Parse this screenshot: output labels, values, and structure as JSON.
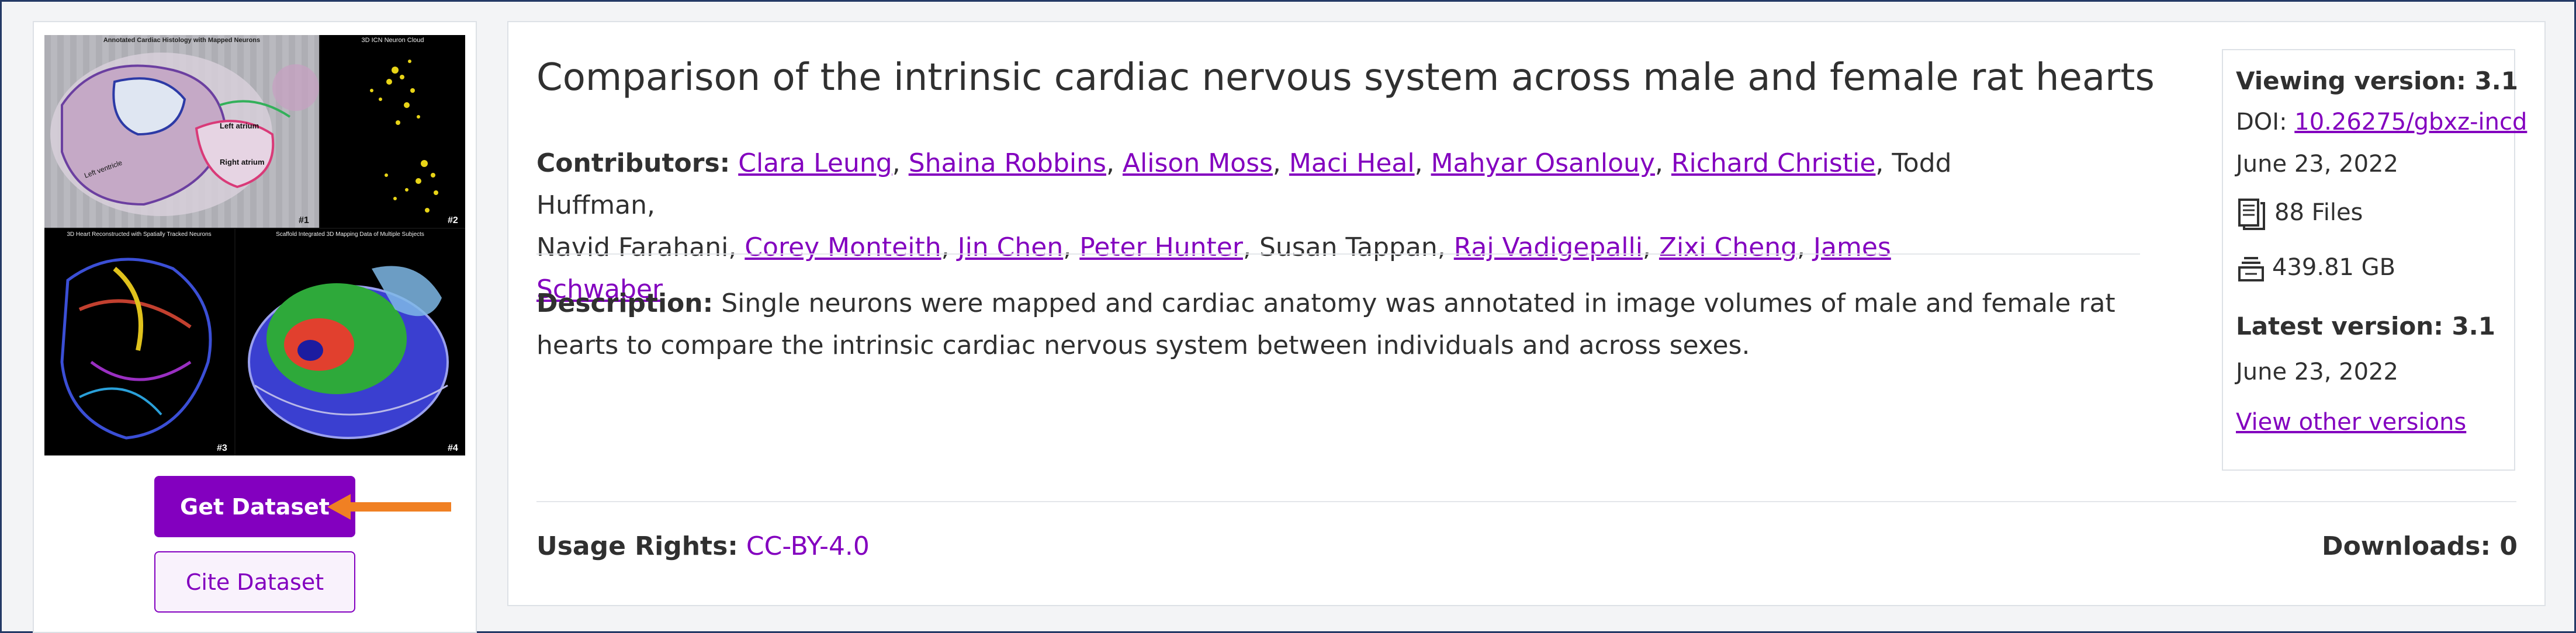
{
  "dataset": {
    "title": "Comparison of the intrinsic cardiac nervous system across male and female rat hearts",
    "contributors_label": "Contributors:",
    "contributors": [
      {
        "name": "Clara Leung",
        "linked": true
      },
      {
        "name": "Shaina Robbins",
        "linked": true
      },
      {
        "name": "Alison Moss",
        "linked": true
      },
      {
        "name": "Maci Heal",
        "linked": true
      },
      {
        "name": "Mahyar Osanlouy",
        "linked": true
      },
      {
        "name": "Richard Christie",
        "linked": true
      },
      {
        "name": "Todd Huffman",
        "linked": false
      },
      {
        "name": "Navid Farahani",
        "linked": false
      },
      {
        "name": "Corey Monteith",
        "linked": true
      },
      {
        "name": "Jin Chen",
        "linked": true
      },
      {
        "name": "Peter Hunter",
        "linked": true
      },
      {
        "name": "Susan Tappan",
        "linked": false
      },
      {
        "name": "Raj Vadigepalli",
        "linked": true
      },
      {
        "name": "Zixi Cheng",
        "linked": true
      },
      {
        "name": "James Schwaber",
        "linked": true
      }
    ],
    "description_label": "Description:",
    "description": "Single neurons were mapped and cardiac anatomy was annotated in image volumes of male and female rat hearts to compare the intrinsic cardiac nervous system between individuals and across sexes.",
    "usage_label": "Usage Rights:",
    "usage_value": "CC-BY-4.0",
    "downloads": "Downloads: 0"
  },
  "thumbnail": {
    "panel1_title": "Annotated Cardiac Histology with Mapped Neurons",
    "panel2_title": "3D ICN Neuron Cloud",
    "panel3_title": "3D Heart Reconstructed with Spatially Tracked Neurons",
    "panel4_title": "Scaffold Integrated 3D Mapping Data of Multiple Subjects",
    "panel1_num": "#1",
    "panel2_num": "#2",
    "panel3_num": "#3",
    "panel4_num": "#4",
    "label_left_atrium": "Left atrium",
    "label_right_atrium": "Right atrium",
    "label_left_ventricle": "Left ventricle"
  },
  "actions": {
    "get_dataset": "Get Dataset",
    "cite_dataset": "Cite Dataset"
  },
  "sidebar": {
    "viewing_version": "Viewing version: 3.1",
    "doi_label": "DOI: ",
    "doi_value": "10.26275/gbxz-incd",
    "viewing_date": "June 23, 2022",
    "files": "88 Files",
    "size": "439.81 GB",
    "latest_version": "Latest version: 3.1",
    "latest_date": "June 23, 2022",
    "view_other": "View other versions"
  },
  "colors": {
    "accent": "#8300bf",
    "arrow": "#f08023",
    "frame_border": "#243a66"
  },
  "icons": [
    "document-stack-icon",
    "storage-icon",
    "arrow-left-icon"
  ]
}
